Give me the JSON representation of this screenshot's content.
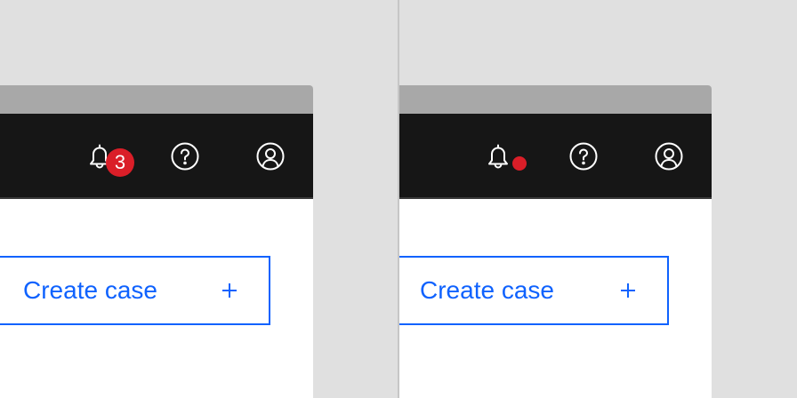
{
  "notifications": {
    "left_count": "3",
    "right_indicator": "dot"
  },
  "icons": {
    "notification": "bell-icon",
    "help": "question-circle-icon",
    "user": "user-avatar-icon",
    "add": "plus-icon"
  },
  "actions": {
    "create_case_label": "Create case"
  },
  "colors": {
    "header_bg": "#161616",
    "chrome_bg": "#a8a8a8",
    "page_bg": "#e0e0e0",
    "accent": "#0f62fe",
    "badge": "#da1e28",
    "icon": "#ffffff"
  }
}
